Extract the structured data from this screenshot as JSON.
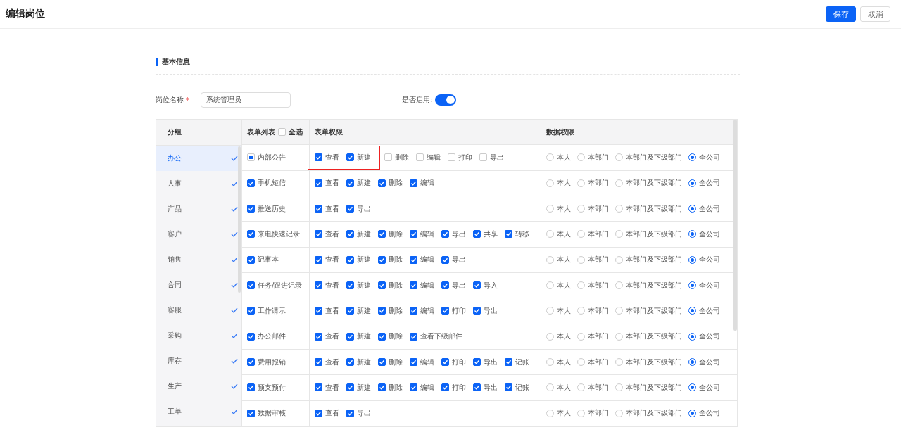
{
  "header": {
    "title": "编辑岗位",
    "buttons": [
      {
        "label": "保存",
        "kind": "primary"
      },
      {
        "label": "取消",
        "kind": "default"
      }
    ]
  },
  "section": {
    "title": "基本信息"
  },
  "form": {
    "name_label": "岗位名称",
    "required_mark": "*",
    "name_value": "系统管理员",
    "enabled_label": "是否启用:",
    "enabled": true
  },
  "table": {
    "columns": {
      "group": "分组",
      "form_list": "表单列表",
      "select_all": "全选",
      "select_all_checked": false,
      "form_perms": "表单权限",
      "data_perms": "数据权限"
    },
    "groups": [
      {
        "label": "办公",
        "selected": true,
        "checked": true
      },
      {
        "label": "人事",
        "selected": false,
        "checked": true
      },
      {
        "label": "产品",
        "selected": false,
        "checked": true
      },
      {
        "label": "客户",
        "selected": false,
        "checked": true
      },
      {
        "label": "销售",
        "selected": false,
        "checked": true
      },
      {
        "label": "合同",
        "selected": false,
        "checked": true
      },
      {
        "label": "客服",
        "selected": false,
        "checked": true
      },
      {
        "label": "采购",
        "selected": false,
        "checked": true
      },
      {
        "label": "库存",
        "selected": false,
        "checked": true
      },
      {
        "label": "生产",
        "selected": false,
        "checked": true
      },
      {
        "label": "工单",
        "selected": false,
        "checked": true
      }
    ],
    "rows": [
      {
        "name": "内部公告",
        "checked": false,
        "partial": true,
        "perms": [
          {
            "label": "查看",
            "checked": true,
            "highlighted": true
          },
          {
            "label": "新建",
            "checked": true,
            "highlighted": true
          },
          {
            "label": "删除",
            "checked": false,
            "highlighted": false
          },
          {
            "label": "编辑",
            "checked": false,
            "highlighted": false
          },
          {
            "label": "打印",
            "checked": false,
            "highlighted": false
          },
          {
            "label": "导出",
            "checked": false,
            "highlighted": false
          }
        ],
        "scopes": [
          {
            "label": "本人",
            "selected": false
          },
          {
            "label": "本部门",
            "selected": false
          },
          {
            "label": "本部门及下级部门",
            "selected": false
          },
          {
            "label": "全公司",
            "selected": true
          }
        ]
      },
      {
        "name": "手机短信",
        "checked": true,
        "partial": false,
        "perms": [
          {
            "label": "查看",
            "checked": true,
            "highlighted": false
          },
          {
            "label": "新建",
            "checked": true,
            "highlighted": false
          },
          {
            "label": "删除",
            "checked": true,
            "highlighted": false
          },
          {
            "label": "编辑",
            "checked": true,
            "highlighted": false
          }
        ],
        "scopes": [
          {
            "label": "本人",
            "selected": false
          },
          {
            "label": "本部门",
            "selected": false
          },
          {
            "label": "本部门及下级部门",
            "selected": false
          },
          {
            "label": "全公司",
            "selected": true
          }
        ]
      },
      {
        "name": "推送历史",
        "checked": true,
        "partial": false,
        "perms": [
          {
            "label": "查看",
            "checked": true,
            "highlighted": false
          },
          {
            "label": "导出",
            "checked": true,
            "highlighted": false
          }
        ],
        "scopes": [
          {
            "label": "本人",
            "selected": false
          },
          {
            "label": "本部门",
            "selected": false
          },
          {
            "label": "本部门及下级部门",
            "selected": false
          },
          {
            "label": "全公司",
            "selected": true
          }
        ]
      },
      {
        "name": "来电快速记录",
        "checked": true,
        "partial": false,
        "perms": [
          {
            "label": "查看",
            "checked": true,
            "highlighted": false
          },
          {
            "label": "新建",
            "checked": true,
            "highlighted": false
          },
          {
            "label": "删除",
            "checked": true,
            "highlighted": false
          },
          {
            "label": "编辑",
            "checked": true,
            "highlighted": false
          },
          {
            "label": "导出",
            "checked": true,
            "highlighted": false
          },
          {
            "label": "共享",
            "checked": true,
            "highlighted": false
          },
          {
            "label": "转移",
            "checked": true,
            "highlighted": false
          }
        ],
        "scopes": [
          {
            "label": "本人",
            "selected": false
          },
          {
            "label": "本部门",
            "selected": false
          },
          {
            "label": "本部门及下级部门",
            "selected": false
          },
          {
            "label": "全公司",
            "selected": true
          }
        ]
      },
      {
        "name": "记事本",
        "checked": true,
        "partial": false,
        "perms": [
          {
            "label": "查看",
            "checked": true,
            "highlighted": false
          },
          {
            "label": "新建",
            "checked": true,
            "highlighted": false
          },
          {
            "label": "删除",
            "checked": true,
            "highlighted": false
          },
          {
            "label": "编辑",
            "checked": true,
            "highlighted": false
          },
          {
            "label": "导出",
            "checked": true,
            "highlighted": false
          }
        ],
        "scopes": [
          {
            "label": "本人",
            "selected": false
          },
          {
            "label": "本部门",
            "selected": false
          },
          {
            "label": "本部门及下级部门",
            "selected": false
          },
          {
            "label": "全公司",
            "selected": true
          }
        ]
      },
      {
        "name": "任务/跟进记录",
        "checked": true,
        "partial": false,
        "perms": [
          {
            "label": "查看",
            "checked": true,
            "highlighted": false
          },
          {
            "label": "新建",
            "checked": true,
            "highlighted": false
          },
          {
            "label": "删除",
            "checked": true,
            "highlighted": false
          },
          {
            "label": "编辑",
            "checked": true,
            "highlighted": false
          },
          {
            "label": "导出",
            "checked": true,
            "highlighted": false
          },
          {
            "label": "导入",
            "checked": true,
            "highlighted": false
          }
        ],
        "scopes": [
          {
            "label": "本人",
            "selected": false
          },
          {
            "label": "本部门",
            "selected": false
          },
          {
            "label": "本部门及下级部门",
            "selected": false
          },
          {
            "label": "全公司",
            "selected": true
          }
        ]
      },
      {
        "name": "工作请示",
        "checked": true,
        "partial": false,
        "perms": [
          {
            "label": "查看",
            "checked": true,
            "highlighted": false
          },
          {
            "label": "新建",
            "checked": true,
            "highlighted": false
          },
          {
            "label": "删除",
            "checked": true,
            "highlighted": false
          },
          {
            "label": "编辑",
            "checked": true,
            "highlighted": false
          },
          {
            "label": "打印",
            "checked": true,
            "highlighted": false
          },
          {
            "label": "导出",
            "checked": true,
            "highlighted": false
          }
        ],
        "scopes": [
          {
            "label": "本人",
            "selected": false
          },
          {
            "label": "本部门",
            "selected": false
          },
          {
            "label": "本部门及下级部门",
            "selected": false
          },
          {
            "label": "全公司",
            "selected": true
          }
        ]
      },
      {
        "name": "办公邮件",
        "checked": true,
        "partial": false,
        "perms": [
          {
            "label": "查看",
            "checked": true,
            "highlighted": false
          },
          {
            "label": "新建",
            "checked": true,
            "highlighted": false
          },
          {
            "label": "删除",
            "checked": true,
            "highlighted": false
          },
          {
            "label": "查看下级邮件",
            "checked": true,
            "highlighted": false
          }
        ],
        "scopes": [
          {
            "label": "本人",
            "selected": false
          },
          {
            "label": "本部门",
            "selected": false
          },
          {
            "label": "本部门及下级部门",
            "selected": false
          },
          {
            "label": "全公司",
            "selected": true
          }
        ]
      },
      {
        "name": "费用报销",
        "checked": true,
        "partial": false,
        "perms": [
          {
            "label": "查看",
            "checked": true,
            "highlighted": false
          },
          {
            "label": "新建",
            "checked": true,
            "highlighted": false
          },
          {
            "label": "删除",
            "checked": true,
            "highlighted": false
          },
          {
            "label": "编辑",
            "checked": true,
            "highlighted": false
          },
          {
            "label": "打印",
            "checked": true,
            "highlighted": false
          },
          {
            "label": "导出",
            "checked": true,
            "highlighted": false
          },
          {
            "label": "记账",
            "checked": true,
            "highlighted": false
          }
        ],
        "scopes": [
          {
            "label": "本人",
            "selected": false
          },
          {
            "label": "本部门",
            "selected": false
          },
          {
            "label": "本部门及下级部门",
            "selected": false
          },
          {
            "label": "全公司",
            "selected": true
          }
        ]
      },
      {
        "name": "预支预付",
        "checked": true,
        "partial": false,
        "perms": [
          {
            "label": "查看",
            "checked": true,
            "highlighted": false
          },
          {
            "label": "新建",
            "checked": true,
            "highlighted": false
          },
          {
            "label": "删除",
            "checked": true,
            "highlighted": false
          },
          {
            "label": "编辑",
            "checked": true,
            "highlighted": false
          },
          {
            "label": "打印",
            "checked": true,
            "highlighted": false
          },
          {
            "label": "导出",
            "checked": true,
            "highlighted": false
          },
          {
            "label": "记账",
            "checked": true,
            "highlighted": false
          }
        ],
        "scopes": [
          {
            "label": "本人",
            "selected": false
          },
          {
            "label": "本部门",
            "selected": false
          },
          {
            "label": "本部门及下级部门",
            "selected": false
          },
          {
            "label": "全公司",
            "selected": true
          }
        ]
      },
      {
        "name": "数据审核",
        "checked": true,
        "partial": false,
        "perms": [
          {
            "label": "查看",
            "checked": true,
            "highlighted": false
          },
          {
            "label": "导出",
            "checked": true,
            "highlighted": false
          }
        ],
        "scopes": [
          {
            "label": "本人",
            "selected": false
          },
          {
            "label": "本部门",
            "selected": false
          },
          {
            "label": "本部门及下级部门",
            "selected": false
          },
          {
            "label": "全公司",
            "selected": true
          }
        ]
      }
    ]
  }
}
